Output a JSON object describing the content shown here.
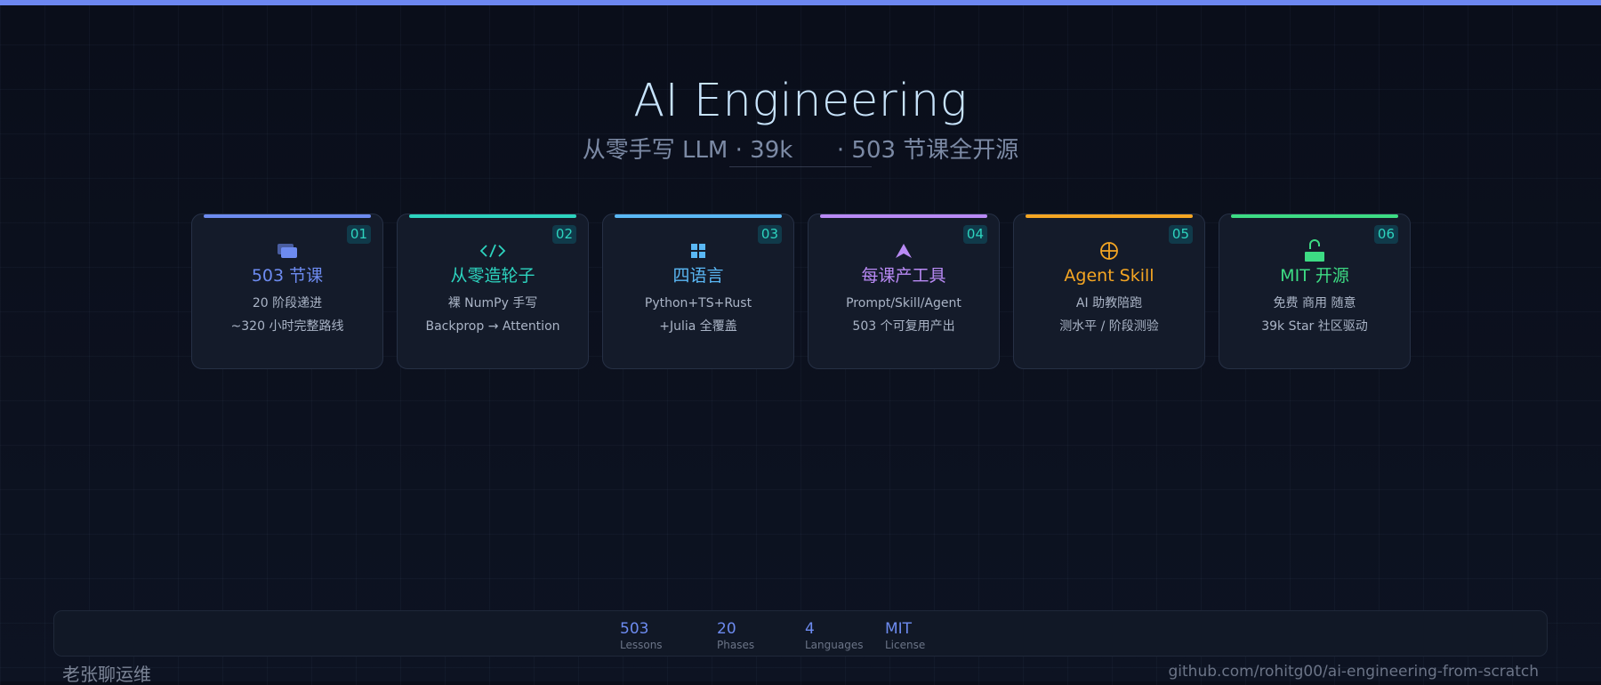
{
  "header": {
    "title": "AI Engineering",
    "subtitle": "从零手写 LLM · 39k      · 503 节课全开源"
  },
  "cards": [
    {
      "number": "01",
      "icon": "stack-icon",
      "title": "503 节课",
      "line1": "20 阶段递进",
      "line2": "~320 小时完整路线",
      "color": "#6d8bf0"
    },
    {
      "number": "02",
      "icon": "code-icon",
      "title": "从零造轮子",
      "line1": "裸 NumPy 手写",
      "line2": "Backprop → Attention",
      "color": "#2dd4bf"
    },
    {
      "number": "03",
      "icon": "grid-icon",
      "title": "四语言",
      "line1": "Python+TS+Rust",
      "line2": "+Julia 全覆盖",
      "color": "#5ab8f5"
    },
    {
      "number": "04",
      "icon": "arrow-up-icon",
      "title": "每课产工具",
      "line1": "Prompt/Skill/Agent",
      "line2": "503 个可复用产出",
      "color": "#b98af5"
    },
    {
      "number": "05",
      "icon": "crosshair-icon",
      "title": "Agent Skill",
      "line1": "AI 助教陪跑",
      "line2": "测水平 / 阶段测验",
      "color": "#f5a623"
    },
    {
      "number": "06",
      "icon": "unlock-icon",
      "title": "MIT 开源",
      "line1": "免费 商用 随意",
      "line2": "39k Star 社区驱动",
      "color": "#3ddc84"
    }
  ],
  "stats": [
    {
      "value": "503",
      "label": "Lessons"
    },
    {
      "value": "20",
      "label": "Phases"
    },
    {
      "value": "4",
      "label": "Languages"
    },
    {
      "value": "MIT",
      "label": "License"
    }
  ],
  "footer": {
    "author": "老张聊运维",
    "repo": "github.com/rohitg00/ai-engineering-from-scratch"
  },
  "colors": {
    "accent": "#6d87f0",
    "title": "#c7e3fb",
    "badge_text": "#2dd4bf"
  }
}
